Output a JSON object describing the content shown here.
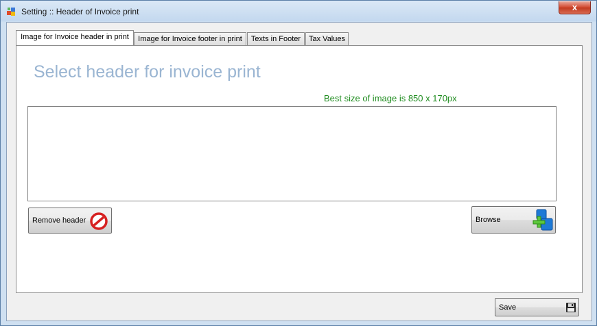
{
  "window": {
    "title": "Setting :: Header of Invoice print",
    "close_label": "x"
  },
  "tabs": [
    {
      "label": "Image for Invoice header in print",
      "active": true
    },
    {
      "label": "Image for Invoice footer in print",
      "active": false
    },
    {
      "label": "Texts in Footer",
      "active": false
    },
    {
      "label": "Tax Values",
      "active": false
    }
  ],
  "panel": {
    "heading": "Select header for invoice print",
    "hint": "Best size of image is 850 x 170px",
    "remove_label": "Remove header",
    "remove_icon": "no-entry-icon",
    "browse_label": "Browse",
    "browse_icon": "add-database-icon"
  },
  "footer": {
    "save_label": "Save",
    "save_icon": "floppy-disk-icon"
  },
  "colors": {
    "heading": "#9ab5d2",
    "hint": "#1f8c1f",
    "remove_icon": "#d62020",
    "browse_icon": "#1e7ad6",
    "plus": "#5ec83c"
  }
}
